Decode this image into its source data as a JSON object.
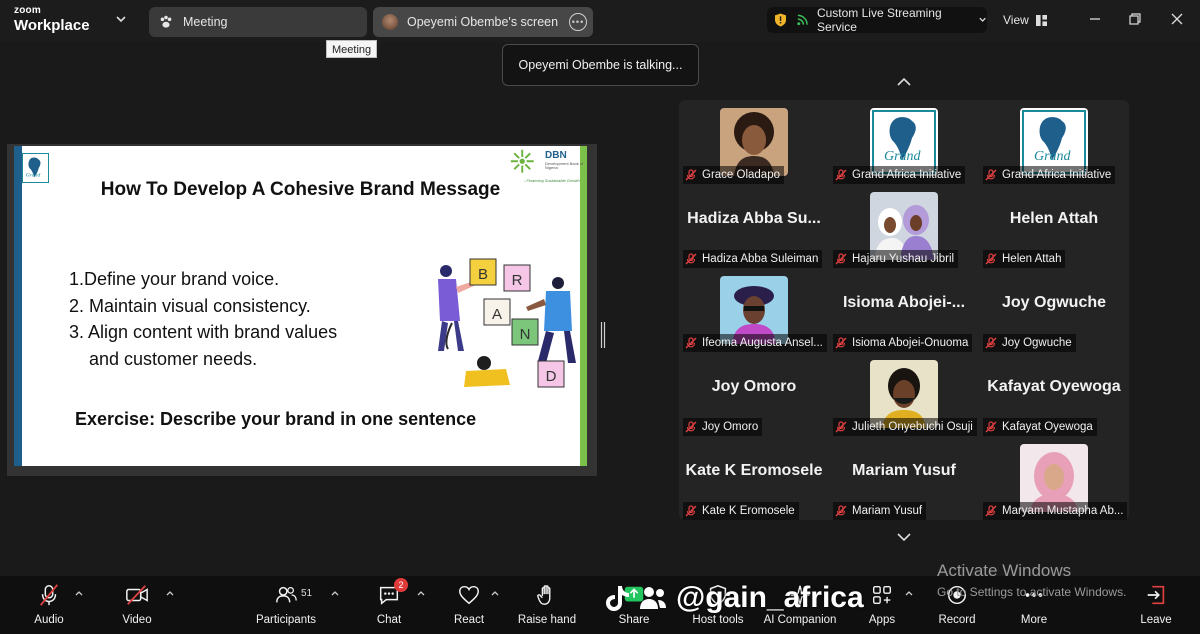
{
  "app": {
    "brand_small": "zoom",
    "brand_large": "Workplace"
  },
  "tabs": [
    {
      "label": "Meeting",
      "icon": "paw-icon"
    },
    {
      "label": "Opeyemi Obembe's screen",
      "icon": "avatar"
    }
  ],
  "tooltip": "Meeting",
  "stream": {
    "label": "Custom Live Streaming Service"
  },
  "view_label": "View",
  "talking_notice": "Opeyemi Obembe is talking...",
  "slide": {
    "title": "How To Develop A Cohesive Brand Message",
    "items": [
      "1.Define your brand voice.",
      "2. Maintain visual consistency.",
      "3. Align content with brand values",
      "and customer needs."
    ],
    "exercise": "Exercise: Describe your brand in one sentence",
    "logo_right_name": "DBN",
    "logo_right_sub": "Development Bank of Nigeria",
    "logo_right_tagline": "...Financing Sustainable Growth",
    "art_letters": [
      "B",
      "R",
      "A",
      "N",
      "D"
    ]
  },
  "participants": [
    {
      "label": "Grace Oladapo",
      "display": "photo",
      "photo": "woman-curly"
    },
    {
      "label": "Grand Africa Initiative",
      "display": "logo"
    },
    {
      "label": "Grand Africa Initiative",
      "display": "logo"
    },
    {
      "label": "Hadiza Abba Suleiman",
      "display": "name",
      "big_name": "Hadiza Abba Su..."
    },
    {
      "label": "Hajaru Yushau Jibril",
      "display": "photo",
      "photo": "women-hijab-group"
    },
    {
      "label": "Helen Attah",
      "display": "name",
      "big_name": "Helen Attah"
    },
    {
      "label": "Ifeoma Augusta Ansel...",
      "display": "photo",
      "photo": "woman-purple"
    },
    {
      "label": "Isioma Abojei-Onuoma",
      "display": "name",
      "big_name": "Isioma  Abojei-..."
    },
    {
      "label": "Joy Ogwuche",
      "display": "name",
      "big_name": "Joy Ogwuche"
    },
    {
      "label": "Joy Omoro",
      "display": "name",
      "big_name": "Joy Omoro"
    },
    {
      "label": "Julieth Onyebuchi Osuji",
      "display": "photo",
      "photo": "woman-mask"
    },
    {
      "label": "Kafayat Oyewoga",
      "display": "name",
      "big_name": "Kafayat Oyewoga"
    },
    {
      "label": "Kate K Eromosele",
      "display": "name",
      "big_name": "Kate K Eromosele"
    },
    {
      "label": "Mariam Yusuf",
      "display": "name",
      "big_name": "Mariam Yusuf"
    },
    {
      "label": "Maryam Mustapha Ab...",
      "display": "photo",
      "photo": "woman-pink-hijab"
    }
  ],
  "toolbar": {
    "audio": "Audio",
    "video": "Video",
    "participants": "Participants",
    "participants_count": "51",
    "chat": "Chat",
    "chat_badge": "2",
    "react": "React",
    "raise_hand": "Raise hand",
    "share": "Share",
    "host_tools": "Host tools",
    "ai_companion": "AI Companion",
    "apps": "Apps",
    "record": "Record",
    "more": "More",
    "leave": "Leave"
  },
  "watermark": "@gain_africa",
  "activate": {
    "line1": "Activate Windows",
    "line2": "Go to Settings to activate Windows."
  },
  "colors": {
    "background": "#1a1a1a",
    "badge": "#e03b3b",
    "muted": "#e04040",
    "slide_left": "#1f5f8c",
    "slide_right": "#7cc24a"
  }
}
